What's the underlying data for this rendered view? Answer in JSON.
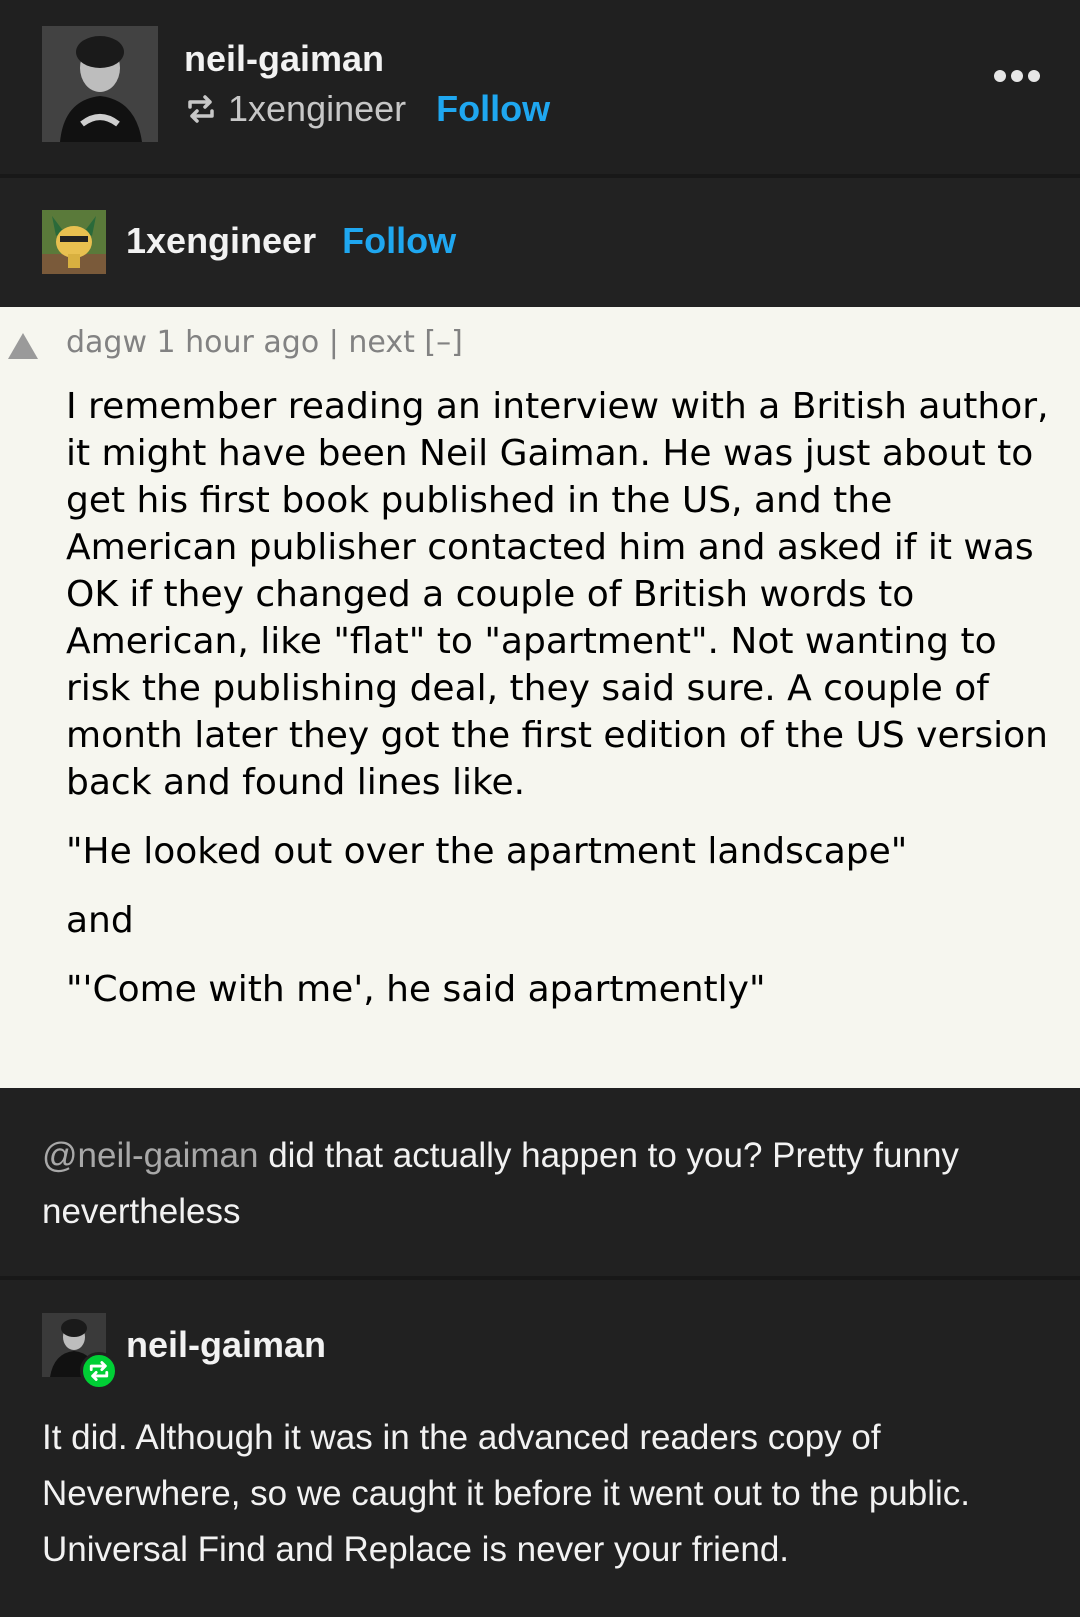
{
  "header": {
    "blog_name": "neil-gaiman",
    "reblogged_from": "1xengineer",
    "follow_label": "Follow"
  },
  "reblog": {
    "blog_name": "1xengineer",
    "follow_label": "Follow"
  },
  "hn_comment": {
    "meta": "dagw 1 hour ago | next [–]",
    "paragraphs": [
      "I remember reading an interview with a British author, it might have been Neil Gaiman. He was just about to get his first book published in the US, and the American publisher contacted him and asked if it was OK if they changed a couple of British words to American, like \"flat\" to \"apartment\". Not wanting to risk the publishing deal, they said sure. A couple of month later they got the first edition of the US version back and found lines like.",
      "\"He looked out over the apartment landscape\"",
      "and",
      "\"'Come with me', he said apartmently\""
    ]
  },
  "comment": {
    "mention": "@neil-gaiman",
    "text": " did that actually happen to you? Pretty funny nevertheless"
  },
  "reply": {
    "blog_name": "neil-gaiman",
    "text": "It did. Although it was in the advanced readers copy of Neverwhere, so we caught it before it went out to the public. Universal Find and Replace is never your friend."
  },
  "colors": {
    "follow": "#1fa7f0",
    "reblog_badge": "#00cf35",
    "hn_background": "#f6f6ef"
  }
}
